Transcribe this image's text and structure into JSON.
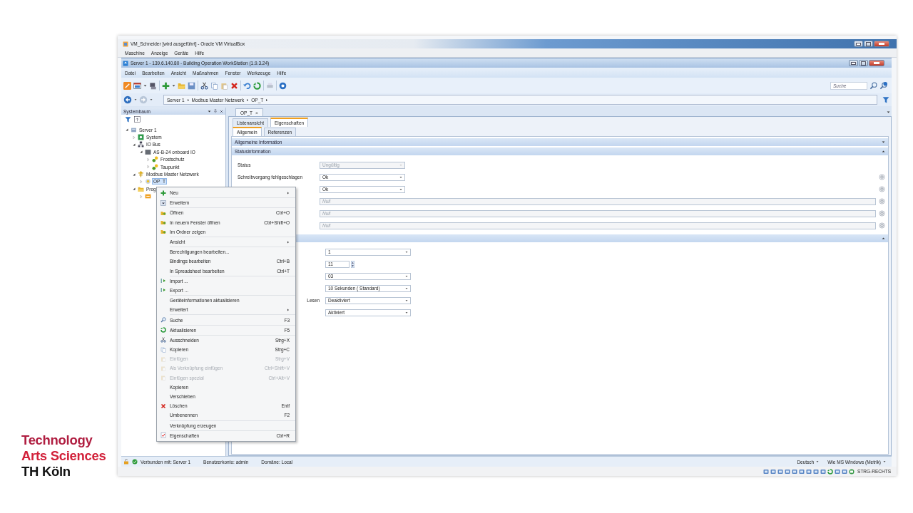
{
  "logo": {
    "lines": [
      {
        "text": "Technology",
        "color": "#b01e41"
      },
      {
        "text": "Arts Sciences",
        "color": "#d2213a"
      },
      {
        "text": "TH Köln",
        "color": "#111111"
      }
    ]
  },
  "vm_window": {
    "title": "VM_Schneider [wird ausgeführt] - Oracle VM VirtualBox",
    "menu": [
      "Maschine",
      "Anzeige",
      "Geräte",
      "Hilfe"
    ],
    "status_text": "STRG-RECHTS"
  },
  "app_window": {
    "title": "Server 1 - 139.6.140.80 - Building Operation WorkStation (1.9.3.24)",
    "menu": [
      "Datei",
      "Bearbeiten",
      "Ansicht",
      "Maßnahmen",
      "Fenster",
      "Werkzeuge",
      "Hilfe"
    ],
    "search": {
      "placeholder": "Suche"
    },
    "breadcrumb": [
      "Server 1",
      "Modbus Master Netzwerk",
      "OP_T"
    ],
    "tree_panel": {
      "title": "Systembaum",
      "tree": [
        {
          "label": "Server 1",
          "kind": "server",
          "expanded": true,
          "selected": false,
          "children": [
            {
              "label": "System",
              "kind": "system",
              "expanded": false,
              "selected": false
            },
            {
              "label": "IO Bus",
              "kind": "bus",
              "expanded": true,
              "selected": false,
              "children": [
                {
                  "label": "AS-B-24 onboard IO",
                  "kind": "device",
                  "expanded": true,
                  "selected": false,
                  "children": [
                    {
                      "label": "Frostschutz",
                      "kind": "point",
                      "expanded": false,
                      "selected": false
                    },
                    {
                      "label": "Taupunkt",
                      "kind": "point",
                      "expanded": false,
                      "selected": false
                    }
                  ]
                }
              ]
            },
            {
              "label": "Modbus Master Netzwerk",
              "kind": "network",
              "expanded": true,
              "selected": false,
              "children": [
                {
                  "label": "OP_T",
                  "kind": "modbus",
                  "expanded": false,
                  "selected": true
                }
              ]
            },
            {
              "label": "Prog",
              "kind": "folder",
              "expanded": true,
              "selected": false,
              "children": [
                {
                  "kind": "program",
                  "expanded": false,
                  "selected": false
                }
              ]
            }
          ]
        }
      ]
    },
    "document_tab": {
      "label": "OP_T",
      "close": "×"
    },
    "view_tabs": [
      {
        "label": "Listenansicht",
        "selected": false
      },
      {
        "label": "Eigenschaften",
        "selected": true
      }
    ],
    "sub_tabs": [
      {
        "label": "Allgemein",
        "selected": true
      },
      {
        "label": "Referenzen",
        "selected": false
      }
    ],
    "sections": [
      {
        "title": "Allgemeine Information",
        "expanded": false
      },
      {
        "title": "Statusinformation",
        "expanded": true,
        "rows": [
          {
            "label": "Status",
            "kind": "dropdown",
            "value": "Ungültig",
            "disabled": true,
            "binding": false
          },
          {
            "label": "Schreibvorgang fehlgeschlagen",
            "kind": "dropdown",
            "value": "Ok",
            "disabled": false,
            "binding": true
          },
          {
            "kind": "dropdown",
            "value": "Ok",
            "disabled": false,
            "binding": true
          },
          {
            "kind": "text",
            "value": "Null",
            "disabled": true,
            "binding": true
          },
          {
            "kind": "text",
            "value": "Null",
            "disabled": true,
            "binding": true
          },
          {
            "kind": "text",
            "value": "Null",
            "disabled": true,
            "binding": true
          }
        ]
      },
      {
        "expanded": true,
        "rows": [
          {
            "kind": "dropdown",
            "value": "1",
            "disabled": false,
            "binding": false
          },
          {
            "kind": "spinner",
            "value": "11",
            "disabled": false,
            "binding": false
          },
          {
            "kind": "dropdown",
            "value": "03",
            "disabled": false,
            "binding": false
          },
          {
            "kind": "dropdown",
            "value": "10 Sekunden ( Standard)",
            "disabled": false,
            "binding": false
          },
          {
            "label": "Lesen",
            "kind": "dropdown",
            "value": "Deaktiviert",
            "disabled": false,
            "binding": false
          },
          {
            "kind": "dropdown",
            "value": "Aktiviert",
            "disabled": false,
            "binding": false
          }
        ]
      }
    ],
    "status_bar": {
      "connection": "Verbunden mit:  Server 1",
      "account": "Benutzerkonto:  admin",
      "domain": "Domäne:  Local",
      "language": "Deutsch",
      "units": "Wie MS Windows (Metrik)"
    }
  },
  "context_menu": {
    "groups": [
      [
        {
          "label": "Neu",
          "submenu": true,
          "disabled": false
        }
      ],
      [
        {
          "label": "Erweitern",
          "submenu": false,
          "disabled": false
        }
      ],
      [
        {
          "label": "Öffnen",
          "shortcut": "Ctrl+O",
          "submenu": false,
          "disabled": false
        },
        {
          "label": "In neuem Fenster öffnen",
          "shortcut": "Ctrl+Shift+O",
          "submenu": false,
          "disabled": false
        },
        {
          "label": "Im Ordner zeigen",
          "submenu": false,
          "disabled": false
        }
      ],
      [
        {
          "label": "Ansicht",
          "submenu": true,
          "disabled": false
        }
      ],
      [
        {
          "label": "Berechtigungen bearbeiten...",
          "submenu": false,
          "disabled": false
        },
        {
          "label": "Bindings bearbeiten",
          "shortcut": "Ctrl+B",
          "submenu": false,
          "disabled": false
        },
        {
          "label": "In Spreadsheet bearbeiten",
          "shortcut": "Ctrl+T",
          "submenu": false,
          "disabled": false
        }
      ],
      [
        {
          "label": "Import ...",
          "submenu": false,
          "disabled": false
        },
        {
          "label": "Export ...",
          "submenu": false,
          "disabled": false
        }
      ],
      [
        {
          "label": "Geräteinformationen aktualisieren",
          "submenu": false,
          "disabled": false
        },
        {
          "label": "Erweitert",
          "submenu": true,
          "disabled": false
        }
      ],
      [
        {
          "label": "Suche",
          "shortcut": "F3",
          "submenu": false,
          "disabled": false
        }
      ],
      [
        {
          "label": "Aktualisieren",
          "shortcut": "F5",
          "submenu": false,
          "disabled": false
        }
      ],
      [
        {
          "label": "Ausschneiden",
          "shortcut": "Strg+X",
          "submenu": false,
          "disabled": false
        },
        {
          "label": "Kopieren",
          "shortcut": "Strg+C",
          "submenu": false,
          "disabled": false
        },
        {
          "label": "Einfügen",
          "shortcut": "Strg+V",
          "submenu": false,
          "disabled": true
        },
        {
          "label": "Als Verknüpfung einfügen",
          "shortcut": "Ctrl+Shift+V",
          "submenu": false,
          "disabled": true
        },
        {
          "label": "Einfügen spezial",
          "shortcut": "Ctrl+Alt+V",
          "submenu": false,
          "disabled": true
        },
        {
          "label": "Kopieren",
          "submenu": false,
          "disabled": false
        },
        {
          "label": "Verschieben",
          "submenu": false,
          "disabled": false
        },
        {
          "label": "Löschen",
          "shortcut": "Entf",
          "submenu": false,
          "disabled": false
        },
        {
          "label": "Umbenennen",
          "shortcut": "F2",
          "submenu": false,
          "disabled": false
        }
      ],
      [
        {
          "label": "Verknüpfung erzeugen",
          "submenu": false,
          "disabled": false
        }
      ],
      [
        {
          "label": "Eigenschaften",
          "shortcut": "Ctrl+R",
          "submenu": false,
          "disabled": false
        }
      ]
    ]
  }
}
